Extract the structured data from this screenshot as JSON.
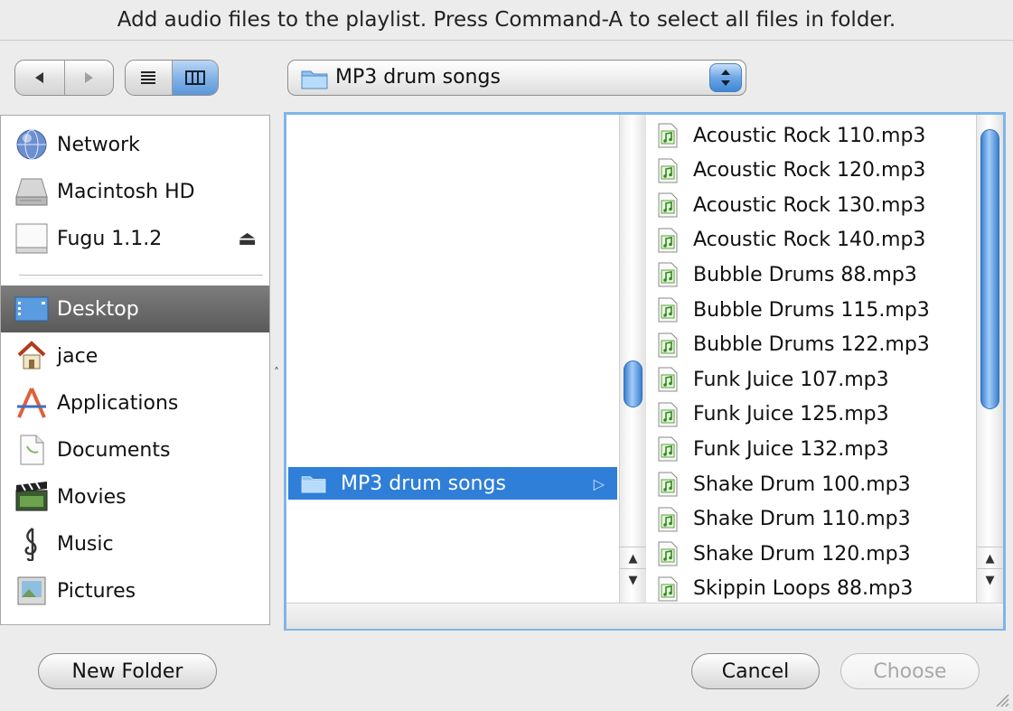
{
  "dialog": {
    "title": "Add audio files to the playlist. Press Command-A to select all files in folder."
  },
  "toolbar": {
    "back_icon": "triangle-left-icon",
    "forward_icon": "triangle-right-icon",
    "list_view_icon": "list-view-icon",
    "column_view_icon": "column-view-icon",
    "location_label": "MP3 drum songs",
    "location_icon": "folder-icon"
  },
  "sidebar": {
    "devices": [
      {
        "label": "Network",
        "icon": "network-globe-icon"
      },
      {
        "label": "Macintosh HD",
        "icon": "hard-drive-icon"
      },
      {
        "label": "Fugu 1.1.2",
        "icon": "disk-image-icon",
        "eject_icon": "⏏"
      }
    ],
    "places": [
      {
        "label": "Desktop",
        "icon": "desktop-icon",
        "selected": true
      },
      {
        "label": "jace",
        "icon": "home-icon"
      },
      {
        "label": "Applications",
        "icon": "applications-icon"
      },
      {
        "label": "Documents",
        "icon": "documents-icon"
      },
      {
        "label": "Movies",
        "icon": "movies-icon"
      },
      {
        "label": "Music",
        "icon": "music-clef-icon"
      },
      {
        "label": "Pictures",
        "icon": "pictures-icon"
      }
    ]
  },
  "browser": {
    "column1": {
      "selected_item": "MP3 drum songs",
      "arrow": "▷"
    },
    "files": [
      "Acoustic Rock 110.mp3",
      "Acoustic Rock 120.mp3",
      "Acoustic Rock 130.mp3",
      "Acoustic Rock 140.mp3",
      "Bubble Drums 88.mp3",
      "Bubble Drums 115.mp3",
      "Bubble Drums 122.mp3",
      "Funk Juice 107.mp3",
      "Funk Juice 125.mp3",
      "Funk Juice 132.mp3",
      "Shake Drum 100.mp3",
      "Shake Drum 110.mp3",
      "Shake Drum 120.mp3",
      "Skippin Loops 88.mp3"
    ],
    "file_icon": "audio-file-icon",
    "scroll_up": "▲",
    "scroll_down": "▼"
  },
  "buttons": {
    "new_folder": "New Folder",
    "cancel": "Cancel",
    "choose": "Choose"
  },
  "colors": {
    "selection": "#2f7ed8",
    "focus_ring": "#7fb5e8",
    "sidebar_selected": "#5a5a5a"
  }
}
